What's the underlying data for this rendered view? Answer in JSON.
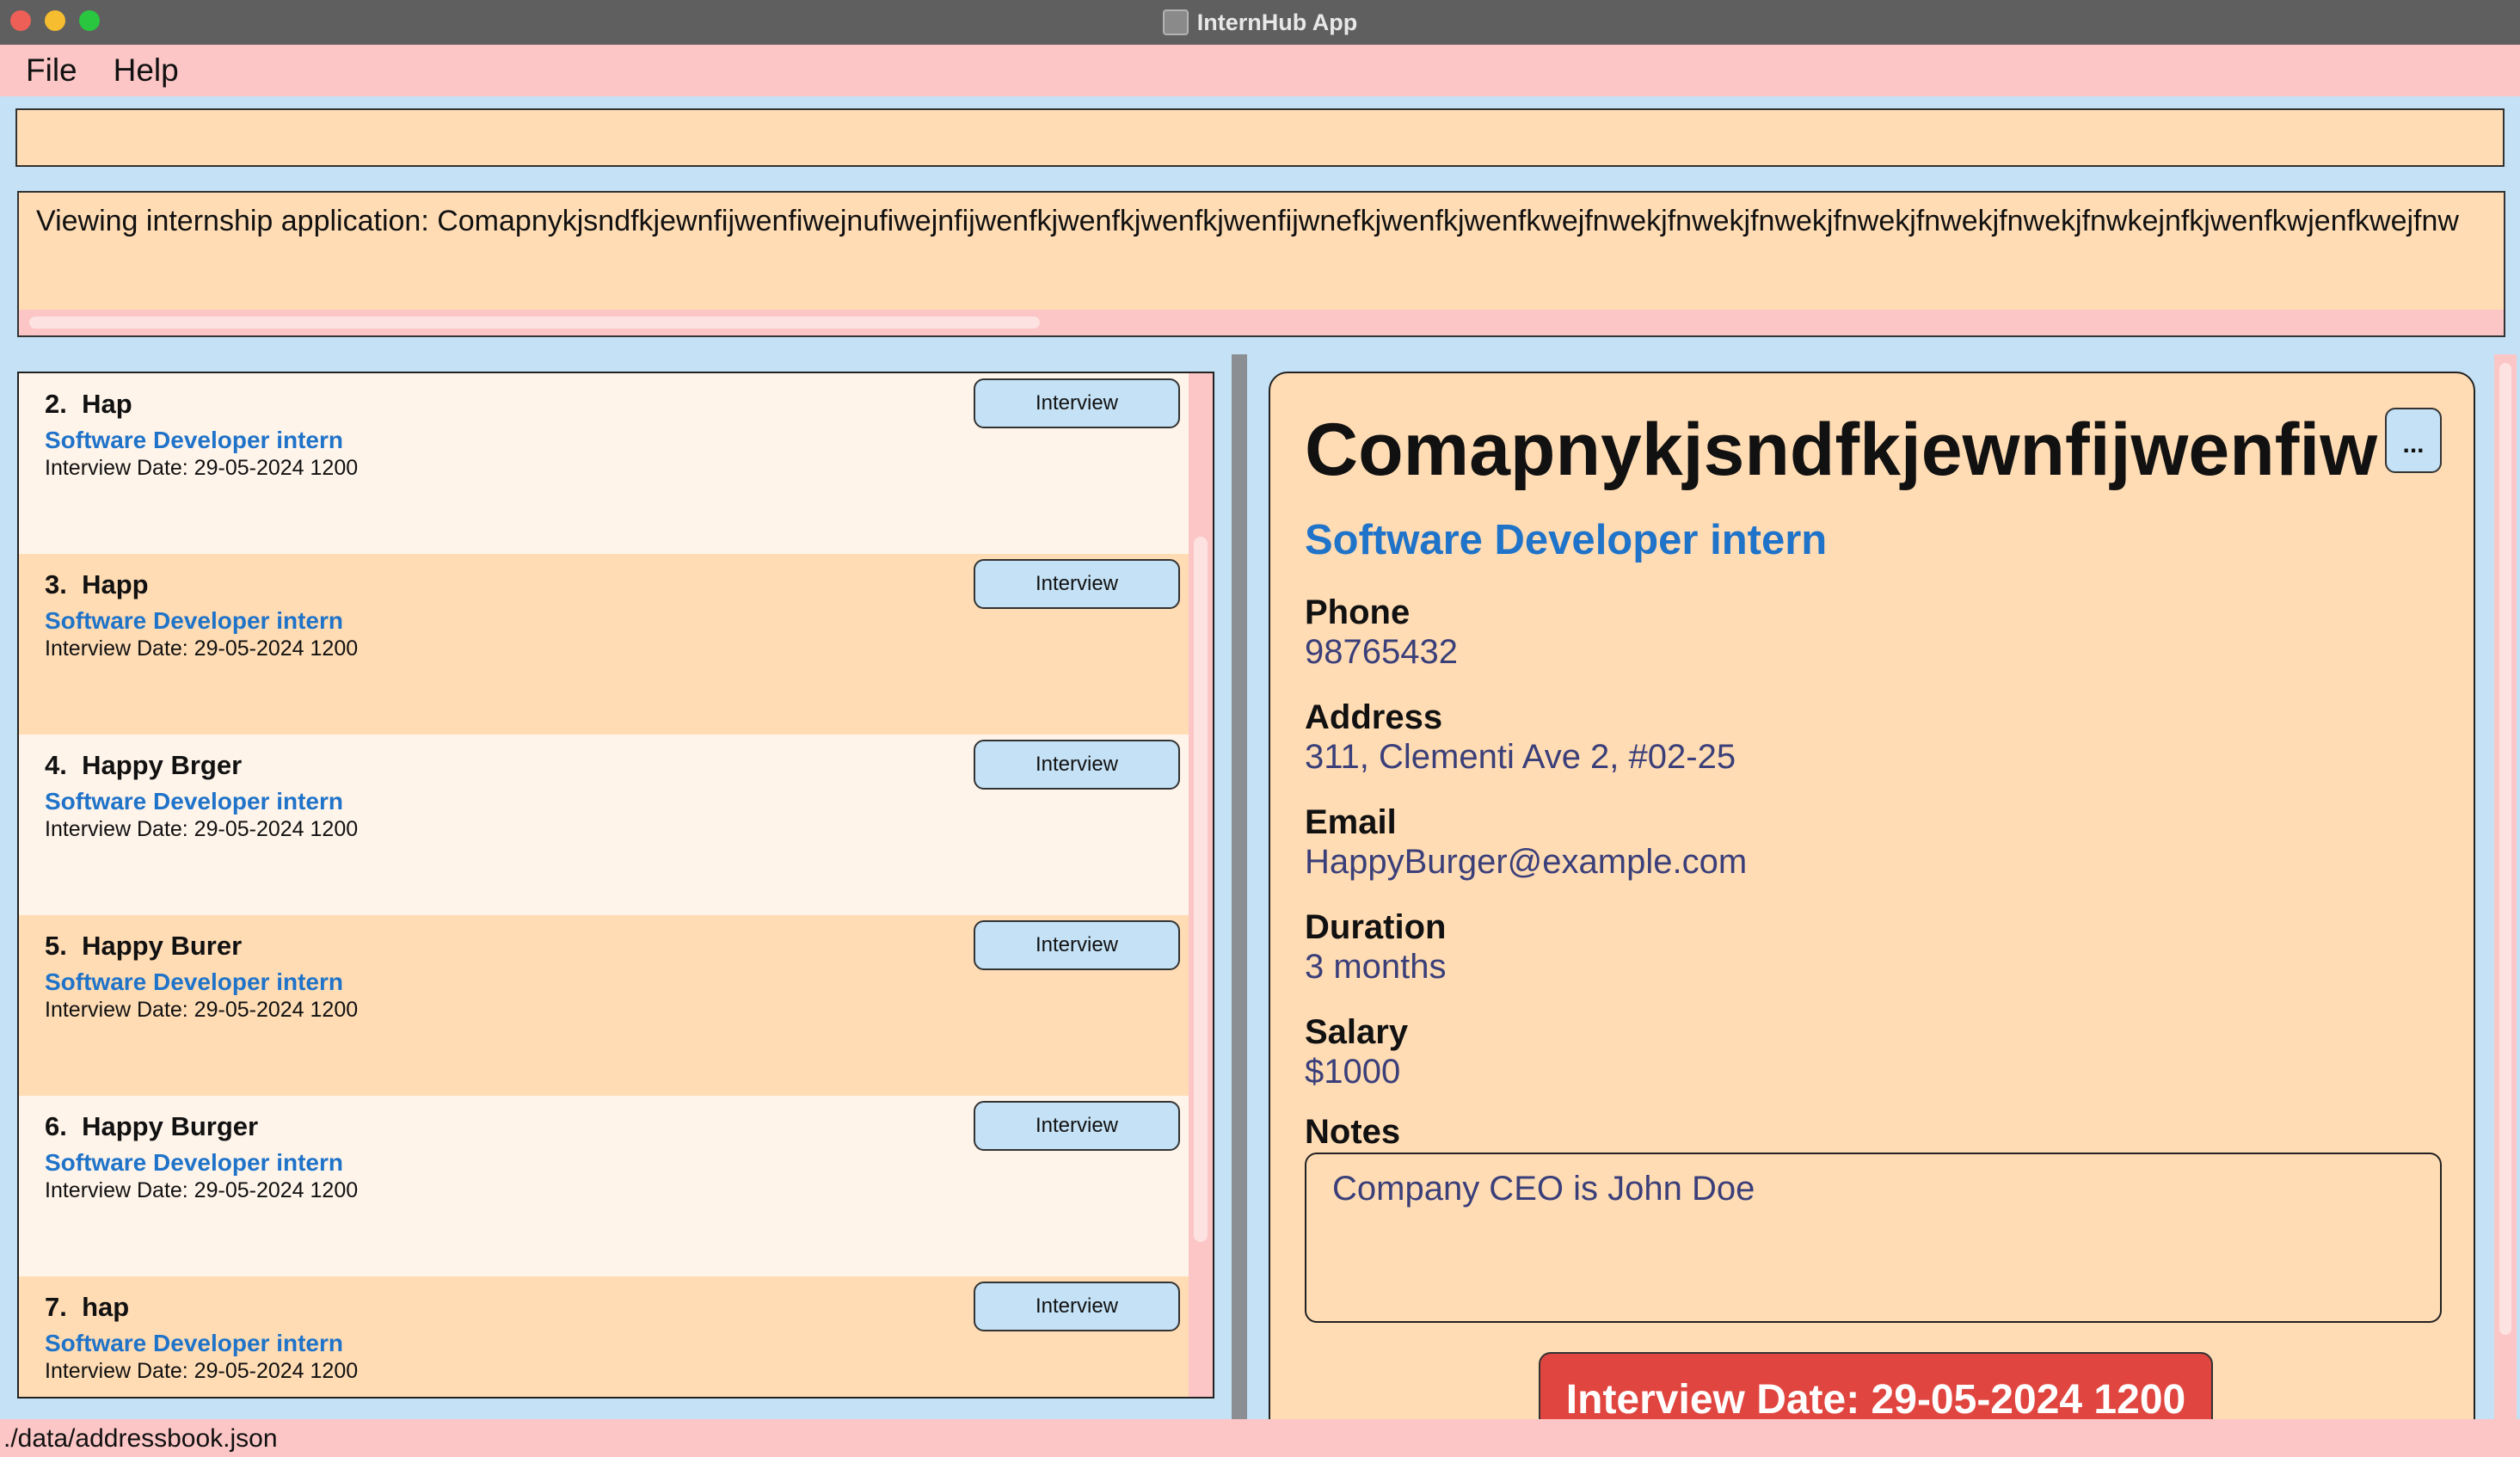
{
  "window": {
    "title": "InternHub App"
  },
  "menu": {
    "file": "File",
    "help": "Help"
  },
  "command": {
    "value": ""
  },
  "result": {
    "text": "Viewing internship application: Comapnykjsndfkjewnfijwenfiwejnufiwejnfijwenfkjwenfkjwenfkjwenfijwnefkjwenfkjwenfkwejfnwekjfnwekjfnwekjfnwekjfnwekjfnwekjfnwkejnfkjwenfkwjenfkwejfnw"
  },
  "list": {
    "items": [
      {
        "index": "2.",
        "name": "Hap",
        "role": "Software Developer intern",
        "date": "Interview Date: 29-05-2024 1200",
        "status": "Interview"
      },
      {
        "index": "3.",
        "name": "Happ",
        "role": "Software Developer intern",
        "date": "Interview Date: 29-05-2024 1200",
        "status": "Interview"
      },
      {
        "index": "4.",
        "name": "Happy Brger",
        "role": "Software Developer intern",
        "date": "Interview Date: 29-05-2024 1200",
        "status": "Interview"
      },
      {
        "index": "5.",
        "name": "Happy Burer",
        "role": "Software Developer intern",
        "date": "Interview Date: 29-05-2024 1200",
        "status": "Interview"
      },
      {
        "index": "6.",
        "name": "Happy Burger",
        "role": "Software Developer intern",
        "date": "Interview Date: 29-05-2024 1200",
        "status": "Interview"
      },
      {
        "index": "7.",
        "name": "hap",
        "role": "Software Developer intern",
        "date": "Interview Date: 29-05-2024 1200",
        "status": "Interview"
      }
    ]
  },
  "detail": {
    "company": "Comapnykjsndfkjewnfijwenfiw",
    "more_label": "...",
    "role": "Software Developer intern",
    "phone_label": "Phone",
    "phone": "98765432",
    "address_label": "Address",
    "address": "311, Clementi Ave 2, #02-25",
    "email_label": "Email",
    "email": "HappyBurger@example.com",
    "duration_label": "Duration",
    "duration": "3 months",
    "salary_label": "Salary",
    "salary": "$1000",
    "notes_label": "Notes",
    "notes": "Company CEO is John Doe",
    "interview_banner": "Interview Date: 29-05-2024 1200"
  },
  "status": {
    "path": "./data/addressbook.json"
  },
  "colors": {
    "accent_blue": "#1f73c9",
    "interview_red": "#e0453f",
    "panel_orange": "#ffdcb4",
    "menu_pink": "#fcc6c6",
    "bg_blue": "#c4e1f5"
  }
}
